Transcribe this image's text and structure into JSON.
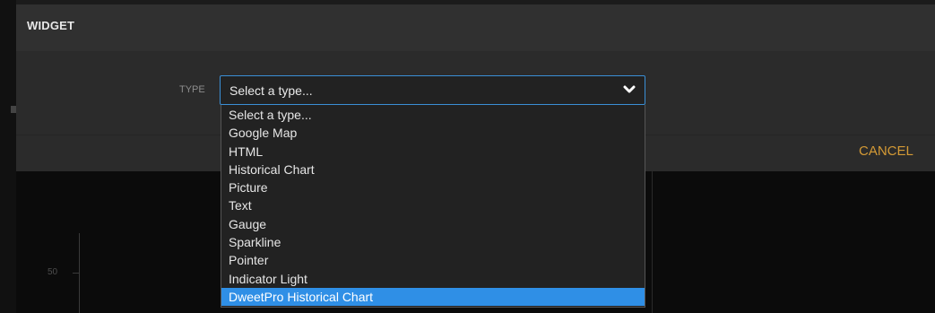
{
  "dialog": {
    "title": "WIDGET",
    "type_label": "TYPE",
    "cancel_label": "CANCEL"
  },
  "select": {
    "value": "Select a type...",
    "options": [
      "Select a type...",
      "Google Map",
      "HTML",
      "Historical Chart",
      "Picture",
      "Text",
      "Gauge",
      "Sparkline",
      "Pointer",
      "Indicator Light",
      "DweetPro Historical Chart"
    ],
    "highlighted_option": "DweetPro Historical Chart"
  },
  "background": {
    "axis_tick_label": "50"
  },
  "colors": {
    "accent": "#d49a35",
    "highlight": "#2f8fe6",
    "focus_border": "#3a8fd6"
  }
}
